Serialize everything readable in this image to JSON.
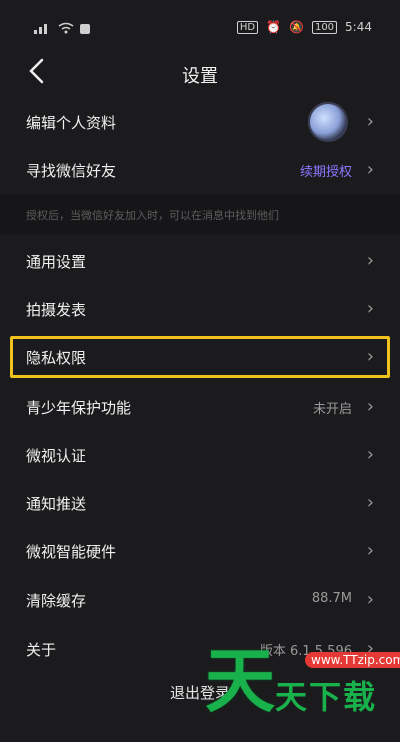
{
  "status": {
    "time": "5:44",
    "battery": "100",
    "hd": "HD"
  },
  "header": {
    "title": "设置"
  },
  "rows": [
    {
      "label": "编辑个人资料",
      "value": "",
      "chevron": "›"
    },
    {
      "label": "寻找微信好友",
      "value": "续期授权",
      "chevron": "›"
    },
    {
      "label": "通用设置",
      "value": "",
      "chevron": "›"
    },
    {
      "label": "拍摄发表",
      "value": "",
      "chevron": "›"
    },
    {
      "label": "隐私权限",
      "value": "",
      "chevron": "›"
    },
    {
      "label": "青少年保护功能",
      "value": "未开启",
      "chevron": "›"
    },
    {
      "label": "微视认证",
      "value": "",
      "chevron": "›"
    },
    {
      "label": "通知推送",
      "value": "",
      "chevron": "›"
    },
    {
      "label": "微视智能硬件",
      "value": "",
      "chevron": "›"
    },
    {
      "label": "清除缓存",
      "value": "88.7M",
      "chevron": "›"
    },
    {
      "label": "关于",
      "value": "版本 6.1.5.596",
      "chevron": "›"
    }
  ],
  "hint": "授权后，当微信好友加入时，可以在消息中找到他们",
  "logout": "退出登录",
  "watermark": {
    "big": "天",
    "small": "天下载",
    "url": "www.TTzip.com"
  },
  "colors": {
    "accent_purple": "#8b77ff",
    "highlight": "#f1c21b",
    "watermark_green": "#19b14b"
  }
}
